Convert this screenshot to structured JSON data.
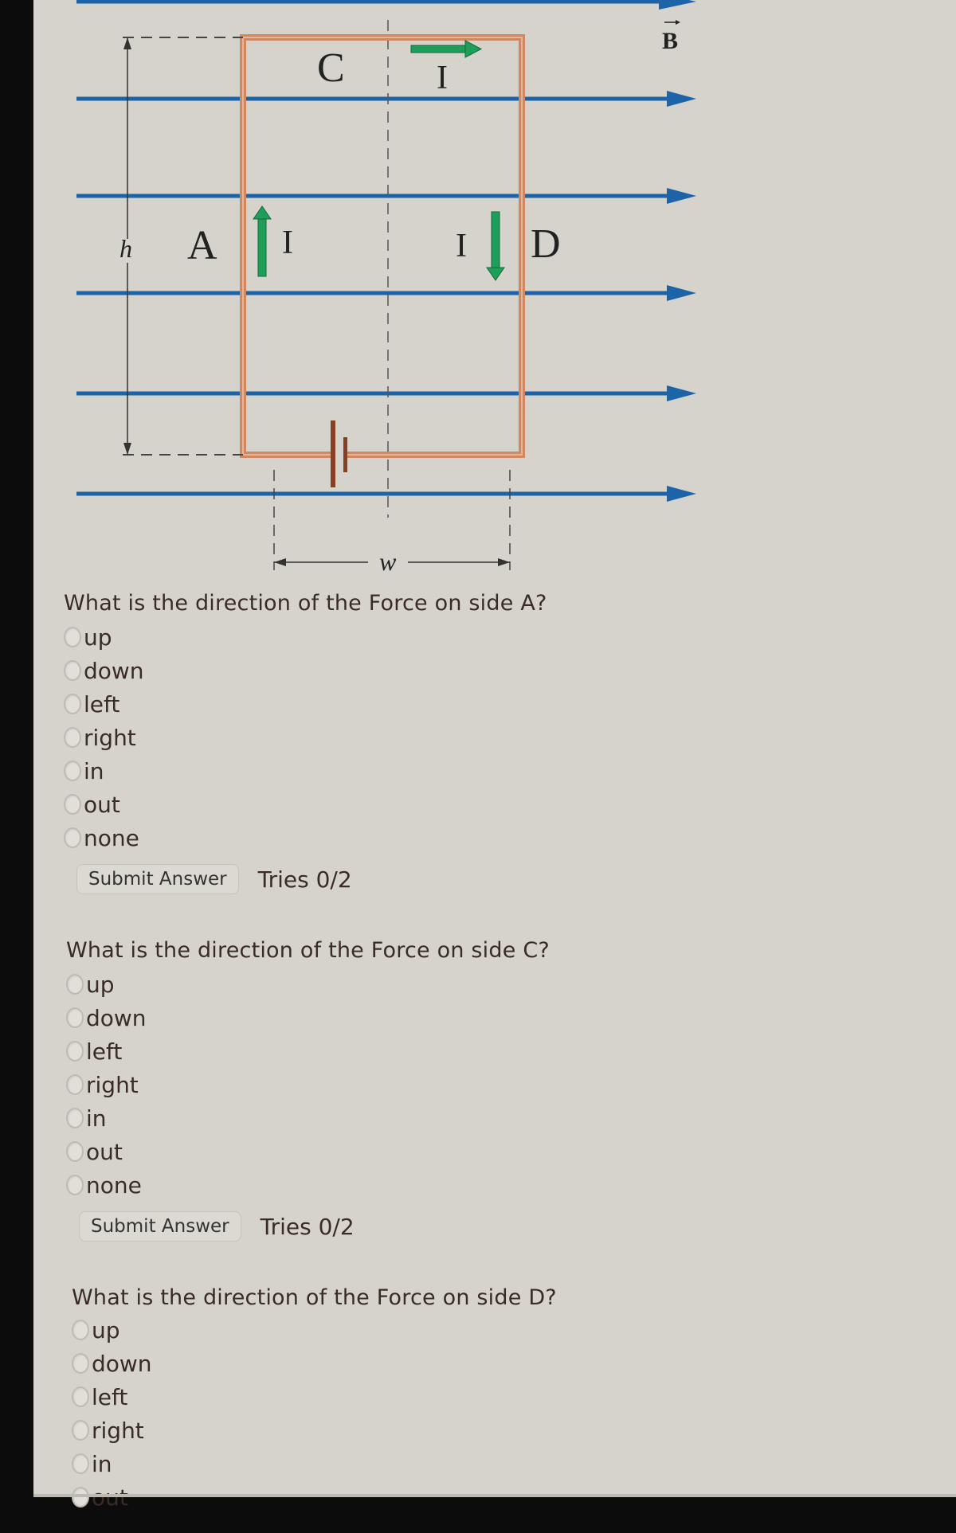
{
  "diagram": {
    "labels": {
      "side_top": "C",
      "side_left": "A",
      "side_right": "D",
      "current_top": "I",
      "current_left": "I",
      "current_right": "I",
      "height": "h",
      "width": "w",
      "field": "B"
    },
    "colors": {
      "field_lines": "#1c63a8",
      "wire": "#cf8860",
      "current_arrows": "#1f9e5a",
      "battery": "#8a3f22"
    }
  },
  "questions": [
    {
      "prompt": "What is the direction of the Force on side A?",
      "options": [
        "up",
        "down",
        "left",
        "right",
        "in",
        "out",
        "none"
      ],
      "submit_label": "Submit Answer",
      "tries": "Tries 0/2"
    },
    {
      "prompt": "What is the direction of the Force on side C?",
      "options": [
        "up",
        "down",
        "left",
        "right",
        "in",
        "out",
        "none"
      ],
      "submit_label": "Submit Answer",
      "tries": "Tries 0/2"
    },
    {
      "prompt": "What is the direction of the Force on side D?",
      "options": [
        "up",
        "down",
        "left",
        "right",
        "in",
        "out"
      ]
    }
  ]
}
